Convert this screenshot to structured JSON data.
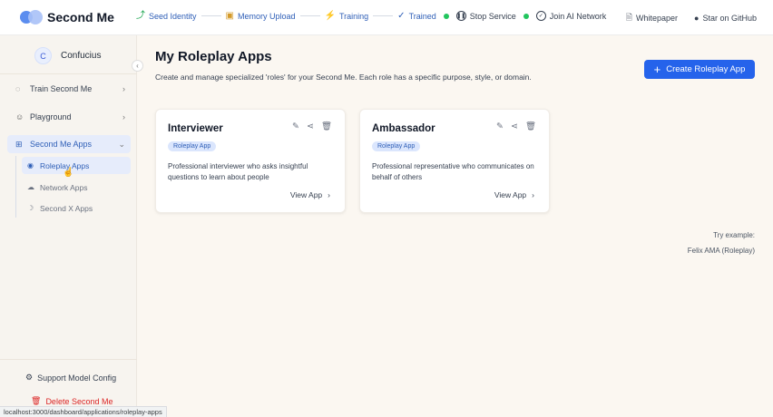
{
  "app": {
    "name": "Second Me"
  },
  "steps": [
    {
      "label": "Seed Identity",
      "icon": "sprout-icon"
    },
    {
      "label": "Memory Upload",
      "icon": "box-icon"
    },
    {
      "label": "Training",
      "icon": "lightning-icon"
    },
    {
      "label": "Trained",
      "icon": "check-icon"
    }
  ],
  "service": {
    "stop_label": "Stop Service",
    "join_label": "Join AI Network",
    "status_color": "#22c55e"
  },
  "top_links": {
    "whitepaper": "Whitepaper",
    "github": "Star on GitHub"
  },
  "profile": {
    "initial": "C",
    "name": "Confucius"
  },
  "sidebar": {
    "items": [
      {
        "label": "Train Second Me"
      },
      {
        "label": "Playground"
      },
      {
        "label": "Second Me Apps"
      }
    ],
    "sub_items": [
      {
        "label": "Roleplay Apps"
      },
      {
        "label": "Network Apps"
      },
      {
        "label": "Second X Apps"
      }
    ],
    "support_label": "Support Model Config",
    "delete_label": "Delete Second Me"
  },
  "status_url": "localhost:3000/dashboard/applications/roleplay-apps",
  "main": {
    "title": "My Roleplay Apps",
    "subtitle": "Create and manage specialized 'roles' for your Second Me. Each role has a specific purpose, style, or domain.",
    "create_label": "Create Roleplay App",
    "accent": "#2563eb",
    "cards": [
      {
        "title": "Interviewer",
        "badge": "Roleplay App",
        "desc": "Professional interviewer who asks insightful questions to learn about people",
        "view_label": "View App"
      },
      {
        "title": "Ambassador",
        "badge": "Roleplay App",
        "desc": "Professional representative who communicates on behalf of others",
        "view_label": "View App"
      }
    ],
    "try_label": "Try example:",
    "try_value": "Felix AMA (Roleplay)"
  }
}
